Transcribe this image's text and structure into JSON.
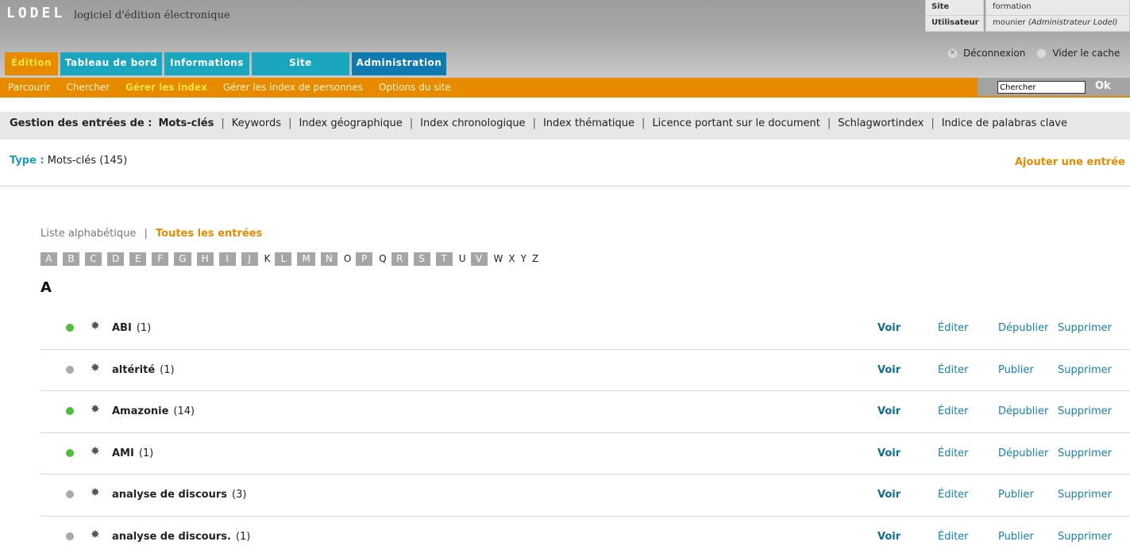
{
  "header": {
    "logo": "LODEL",
    "tagline": "logiciel d'édition électronique",
    "site_label": "Site",
    "site_value": "formation",
    "user_label": "Utilisateur",
    "user_value": "mounier",
    "user_role": "(Administrateur Lodel)",
    "logout_label": "Déconnexion",
    "clear_cache_label": "Vider le cache"
  },
  "tabs": [
    "Édition",
    "Tableau de bord",
    "Informations",
    "Site",
    "Administration"
  ],
  "subnav": {
    "items": [
      "Parcourir",
      "Chercher",
      "Gérer les index",
      "Gérer les index de personnes",
      "Options du site"
    ],
    "active_index": 2,
    "search_value": "Chercher",
    "search_button": "Ok"
  },
  "index_bar": {
    "lead": "Gestion des entrées de :",
    "types": [
      "Mots-clés",
      "Keywords",
      "Index géographique",
      "Index chronologique",
      "Index thématique",
      "Licence portant sur le document",
      "Schlagwortindex",
      "Indice de palabras clave"
    ]
  },
  "type_line": {
    "label": "Type :",
    "value": "Mots-clés (145)"
  },
  "add_entry": "Ajouter une entrée",
  "list_mode": {
    "alpha": "Liste alphabétique",
    "all": "Toutes les entrées"
  },
  "letters": [
    {
      "l": "A",
      "on": true
    },
    {
      "l": "B",
      "on": true
    },
    {
      "l": "C",
      "on": true
    },
    {
      "l": "D",
      "on": true
    },
    {
      "l": "E",
      "on": true
    },
    {
      "l": "F",
      "on": true
    },
    {
      "l": "G",
      "on": true
    },
    {
      "l": "H",
      "on": true
    },
    {
      "l": "I",
      "on": true
    },
    {
      "l": "J",
      "on": true
    },
    {
      "l": "K",
      "on": false
    },
    {
      "l": "L",
      "on": true
    },
    {
      "l": "M",
      "on": true
    },
    {
      "l": "N",
      "on": true
    },
    {
      "l": "O",
      "on": false
    },
    {
      "l": "P",
      "on": true
    },
    {
      "l": "Q",
      "on": false
    },
    {
      "l": "R",
      "on": true
    },
    {
      "l": "S",
      "on": true
    },
    {
      "l": "T",
      "on": true
    },
    {
      "l": "U",
      "on": false
    },
    {
      "l": "V",
      "on": true
    },
    {
      "l": "W",
      "on": false
    },
    {
      "l": "X",
      "on": false
    },
    {
      "l": "Y",
      "on": false
    },
    {
      "l": "Z",
      "on": false
    }
  ],
  "section_letter": "A",
  "colors": {
    "published": "#4cbf3a",
    "unpublished": "#a9a9a9",
    "accent": "#e78a00"
  },
  "actions": {
    "view": "Voir",
    "edit": "Éditer",
    "publish": "Publier",
    "unpublish": "Dépublier",
    "delete": "Supprimer"
  },
  "entries": [
    {
      "name": "ABI",
      "count": "(1)",
      "published": true
    },
    {
      "name": "altérité",
      "count": "(1)",
      "published": false
    },
    {
      "name": "Amazonie",
      "count": "(14)",
      "published": true
    },
    {
      "name": "AMI",
      "count": "(1)",
      "published": true
    },
    {
      "name": "analyse de discours",
      "count": "(3)",
      "published": false
    },
    {
      "name": "analyse de discours.",
      "count": "(1)",
      "published": false
    }
  ]
}
